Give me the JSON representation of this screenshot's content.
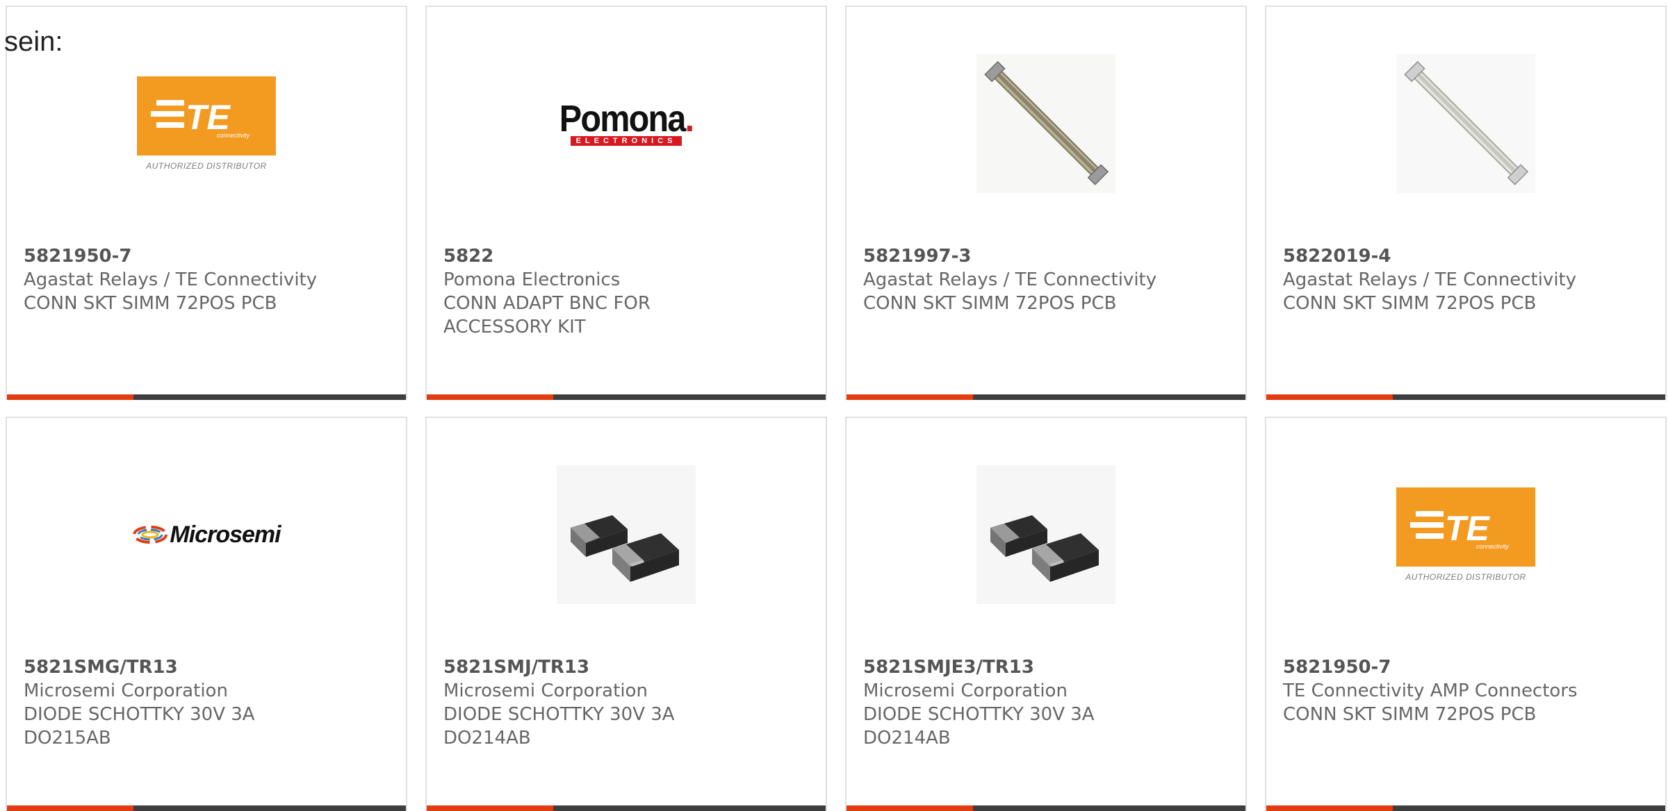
{
  "lead_text": "sein:",
  "colors": {
    "accent": "#e23d12",
    "bar": "#3e3e3e",
    "te_orange": "#f39a21",
    "pomona_red": "#d71920"
  },
  "products": [
    {
      "part_number": "5821950-7",
      "manufacturer": "Agastat Relays / TE Connectivity",
      "description_lines": [
        "CONN SKT SIMM 72POS PCB"
      ],
      "image": "te-logo",
      "logo_caption": "AUTHORIZED DISTRIBUTOR"
    },
    {
      "part_number": "5822",
      "manufacturer": "Pomona Electronics",
      "description_lines": [
        "CONN ADAPT BNC FOR",
        "ACCESSORY KIT"
      ],
      "image": "pomona-logo",
      "logo_word": "Pomona",
      "logo_sub": "ELECTRONICS"
    },
    {
      "part_number": "5821997-3",
      "manufacturer": "Agastat Relays / TE Connectivity",
      "description_lines": [
        "CONN SKT SIMM 72POS PCB"
      ],
      "image": "simm-socket"
    },
    {
      "part_number": "5822019-4",
      "manufacturer": "Agastat Relays / TE Connectivity",
      "description_lines": [
        "CONN SKT SIMM 72POS PCB"
      ],
      "image": "simm-socket-light"
    },
    {
      "part_number": "5821SMG/TR13",
      "manufacturer": "Microsemi Corporation",
      "description_lines": [
        "DIODE SCHOTTKY 30V 3A",
        "DO215AB"
      ],
      "image": "microsemi-logo",
      "logo_word": "Microsemi"
    },
    {
      "part_number": "5821SMJ/TR13",
      "manufacturer": "Microsemi Corporation",
      "description_lines": [
        "DIODE SCHOTTKY 30V 3A",
        "DO214AB"
      ],
      "image": "smd-diodes"
    },
    {
      "part_number": "5821SMJE3/TR13",
      "manufacturer": "Microsemi Corporation",
      "description_lines": [
        "DIODE SCHOTTKY 30V 3A",
        "DO214AB"
      ],
      "image": "smd-diodes"
    },
    {
      "part_number": "5821950-7",
      "manufacturer": "TE Connectivity AMP Connectors",
      "description_lines": [
        "CONN SKT SIMM 72POS PCB"
      ],
      "image": "te-logo",
      "logo_caption": "AUTHORIZED DISTRIBUTOR"
    }
  ]
}
